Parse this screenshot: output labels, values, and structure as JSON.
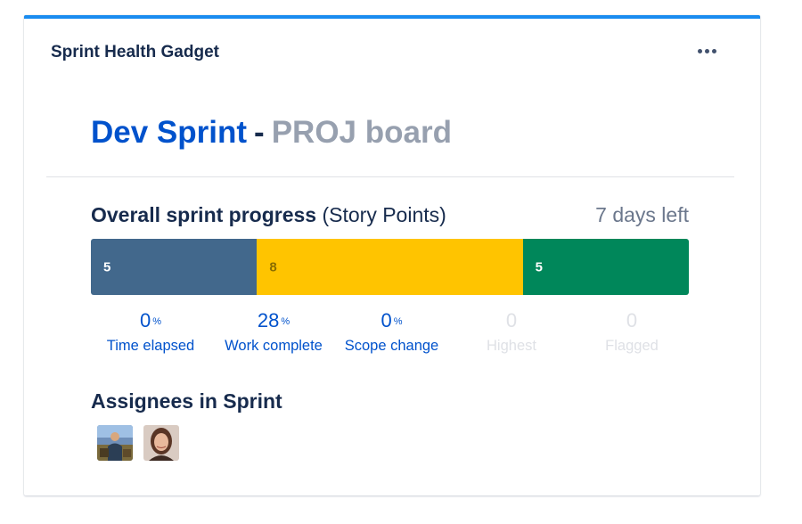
{
  "gadget": {
    "title": "Sprint Health Gadget",
    "more_icon": "more-horizontal-icon"
  },
  "sprint": {
    "name": "Dev Sprint",
    "separator": "-",
    "board": "PROJ board"
  },
  "progress": {
    "title_bold": "Overall sprint progress",
    "title_suffix": "(Story Points)",
    "days_left": "7 days left",
    "segments": [
      {
        "status": "to-do",
        "count": "5",
        "value": 5,
        "color": "#42688c",
        "text_color": "#ffffff"
      },
      {
        "status": "in-progress",
        "count": "8",
        "value": 8,
        "color": "#ffc400",
        "text_color": "#8a6d00"
      },
      {
        "status": "done",
        "count": "5",
        "value": 5,
        "color": "#00875a",
        "text_color": "#ffffff"
      }
    ]
  },
  "metrics": [
    {
      "key": "time-elapsed",
      "value": "0",
      "unit": "%",
      "label": "Time elapsed",
      "active": true
    },
    {
      "key": "work-complete",
      "value": "28",
      "unit": "%",
      "label": "Work complete",
      "active": true
    },
    {
      "key": "scope-change",
      "value": "0",
      "unit": "%",
      "label": "Scope change",
      "active": true
    },
    {
      "key": "highest",
      "value": "0",
      "unit": "",
      "label": "Highest",
      "active": false
    },
    {
      "key": "flagged",
      "value": "0",
      "unit": "",
      "label": "Flagged",
      "active": false
    }
  ],
  "assignees": {
    "title": "Assignees in Sprint",
    "people": [
      {
        "avatar_icon": "user-avatar-outdoor"
      },
      {
        "avatar_icon": "user-avatar-portrait"
      }
    ]
  },
  "colors": {
    "accent": "#1a8cf0",
    "link": "#0052cc",
    "text": "#172b4d",
    "muted": "#97a0af"
  }
}
